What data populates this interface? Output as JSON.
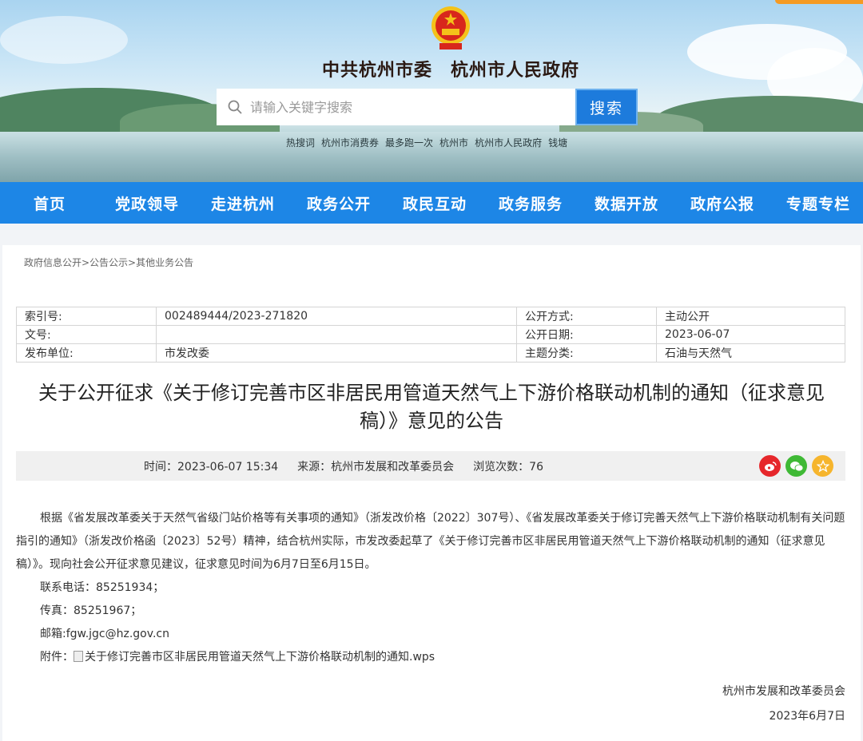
{
  "header": {
    "site_title": "中共杭州市委　杭州市人民政府",
    "search_placeholder": "请输入关键字搜索",
    "search_button": "搜索",
    "hot_links": [
      "热搜词",
      "杭州市消费券",
      "最多跑一次",
      "杭州市",
      "杭州市人民政府",
      "钱塘"
    ]
  },
  "nav": [
    "首页",
    "党政领导",
    "走进杭州",
    "政务公开",
    "政民互动",
    "政务服务",
    "数据开放",
    "政府公报",
    "专题专栏"
  ],
  "breadcrumb": "政府信息公开>公告公示>其他业务公告",
  "meta": {
    "rows": [
      {
        "k1": "索引号:",
        "v1": "002489444/2023-271820",
        "k2": "公开方式:",
        "v2": "主动公开"
      },
      {
        "k1": "文号:",
        "v1": "",
        "k2": "公开日期:",
        "v2": "2023-06-07"
      },
      {
        "k1": "发布单位:",
        "v1": "市发改委",
        "k2": "主题分类:",
        "v2": "石油与天然气"
      }
    ]
  },
  "article": {
    "title_line1": "关于公开征求《关于修订完善市区非居民用管道天然气上下游价格联动机制的通知（征求意见",
    "title_line2": "稿）》意见的公告",
    "time": "时间：2023-06-07 15:34",
    "source": "来源：杭州市发展和改革委员会",
    "views": "浏览次数：76",
    "para1": "根据《省发展改革委关于天然气省级门站价格等有关事项的通知》（浙发改价格〔2022〕307号）、《省发展改革委关于修订完善天然气上下游价格联动机制有关问题指引的通知》（浙发改价格函〔2023〕52号）精神，结合杭州实际，市发改委起草了《关于修订完善市区非居民用管道天然气上下游价格联动机制的通知（征求意见稿）》。现向社会公开征求意见建议，征求意见时间为6月7日至6月15日。",
    "phone": "联系电话：85251934；",
    "fax": "传真：85251967；",
    "email": "邮箱:fgw.jgc@hz.gov.cn",
    "attachment_label": "附件：",
    "attachment_name": "关于修订完善市区非居民用管道天然气上下游价格联动机制的通知.wps",
    "signature": "杭州市发展和改革委员会",
    "sign_date": "2023年6月7日"
  },
  "colors": {
    "nav_bg": "#1d86e6",
    "search_btn": "#1d7bdc",
    "weibo": "#e6272b",
    "wechat": "#3fb935",
    "favorite": "#f6b52d"
  },
  "icons": [
    "national-emblem-icon",
    "search-icon",
    "weibo-icon",
    "wechat-icon",
    "favorite-icon",
    "attachment-icon"
  ]
}
